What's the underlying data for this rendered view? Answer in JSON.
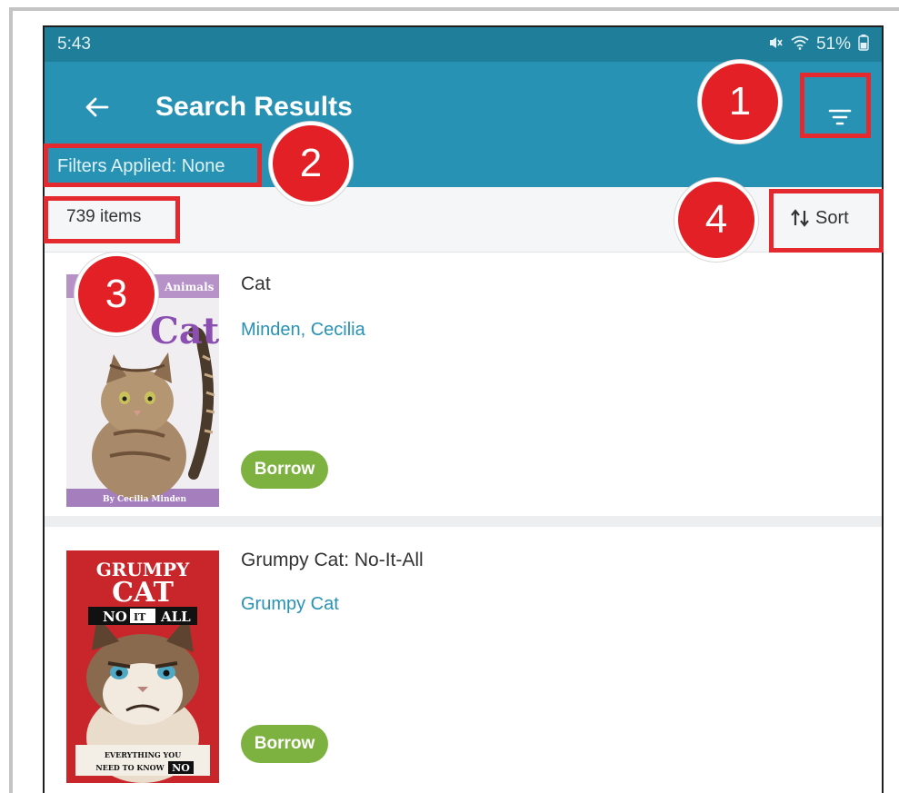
{
  "status_bar": {
    "time": "5:43",
    "battery": "51%",
    "icons": [
      "mute-icon",
      "wifi-icon",
      "battery-icon"
    ]
  },
  "app_bar": {
    "title": "Search Results",
    "filters_applied": "Filters Applied: None",
    "back_icon": "arrow-left-icon",
    "filter_icon": "filter-icon"
  },
  "results_bar": {
    "count": "739 items",
    "sort_label": "Sort",
    "sort_icon": "sort-icon"
  },
  "results": [
    {
      "title": "Cat",
      "author": "Minden, Cecilia",
      "action": "Borrow",
      "cover": {
        "heading": "Cat",
        "series": "Animals",
        "byline": "By Cecilia Minden"
      }
    },
    {
      "title": "Grumpy Cat: No-It-All",
      "author": "Grumpy Cat",
      "action": "Borrow",
      "cover": {
        "line1": "GRUMPY",
        "line2": "CAT",
        "line3a": "NO",
        "line3b": "IT",
        "line3c": "ALL",
        "tagline1": "EVERYTHING YOU",
        "tagline2": "NEED TO KNOW",
        "tagline3": "NO"
      }
    }
  ],
  "annotations": [
    "1",
    "2",
    "3",
    "4"
  ],
  "colors": {
    "status_bar": "#1f7e9a",
    "app_bar": "#2892b4",
    "author_link": "#2892b4",
    "borrow_button": "#7db241",
    "annotation_red": "#e22025"
  }
}
